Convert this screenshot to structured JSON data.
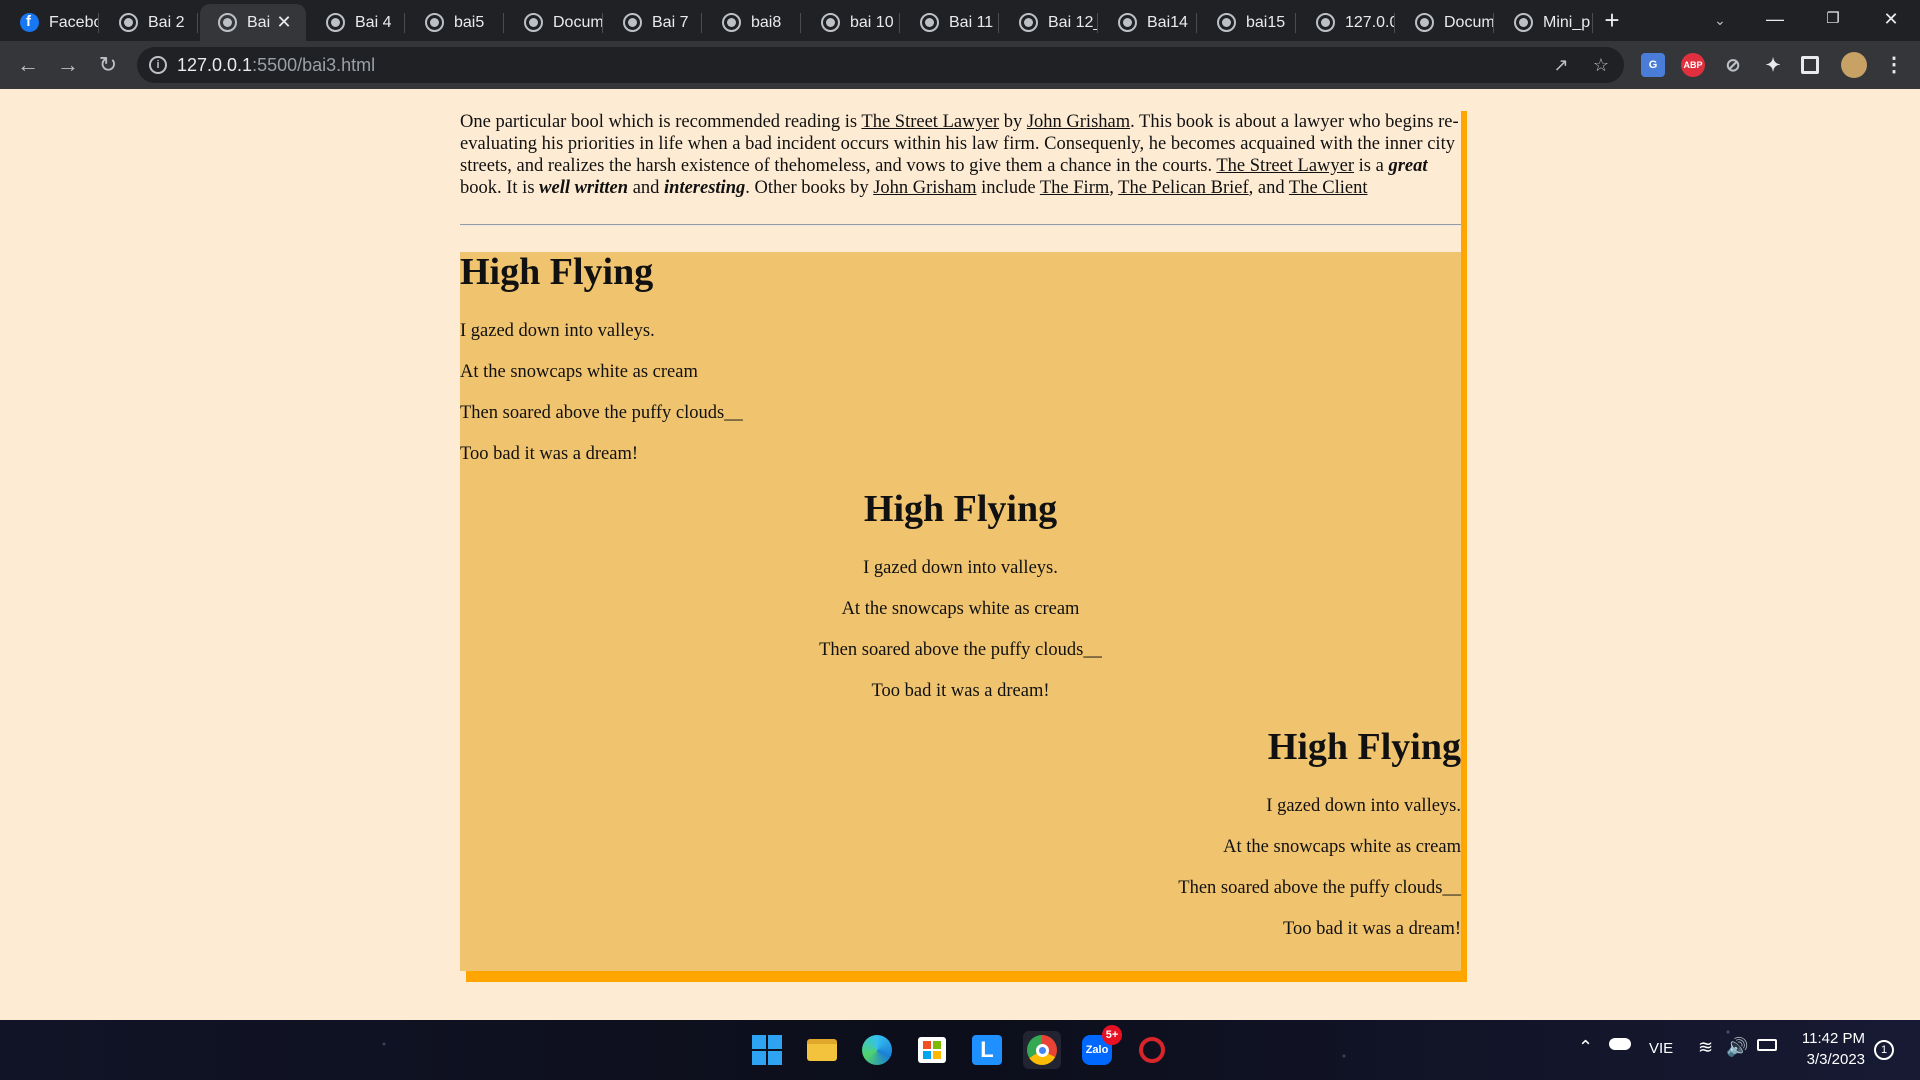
{
  "browser": {
    "tabs": [
      {
        "title": "Facebo",
        "icon": "facebook-icon"
      },
      {
        "title": "Bai 2",
        "icon": "globe-icon"
      },
      {
        "title": "Bai",
        "icon": "globe-icon",
        "active": true
      },
      {
        "title": "Bai 4",
        "icon": "globe-icon"
      },
      {
        "title": "bai5",
        "icon": "globe-icon"
      },
      {
        "title": "Docum",
        "icon": "globe-icon"
      },
      {
        "title": "Bai 7",
        "icon": "globe-icon"
      },
      {
        "title": "bai8",
        "icon": "globe-icon"
      },
      {
        "title": "bai 10",
        "icon": "globe-icon"
      },
      {
        "title": "Bai 11",
        "icon": "globe-icon"
      },
      {
        "title": "Bai 12_",
        "icon": "globe-icon"
      },
      {
        "title": "Bai14",
        "icon": "globe-icon"
      },
      {
        "title": "bai15",
        "icon": "globe-icon"
      },
      {
        "title": "127.0.0",
        "icon": "globe-icon"
      },
      {
        "title": "Docum",
        "icon": "globe-icon"
      },
      {
        "title": "Mini_p",
        "icon": "globe-icon"
      }
    ],
    "close_tab_glyph": "✕",
    "new_tab_glyph": "+",
    "url_host": "127.0.0.1",
    "url_path": ":5500/bai3.html",
    "extensions": {
      "translate": "G",
      "adblock": "ABP",
      "compass": "⊘"
    }
  },
  "page": {
    "intro": {
      "t1": "One particular bool which is recommended reading is ",
      "link_street_lawyer": "The Street Lawyer",
      "t2": " by ",
      "link_author": "John Grisham",
      "t3": ". This book is about a lawyer who begins re-evaluating his priorities in life when a bad incident occurs within his law firm. Consequenly, he becomes acquained with the inner city streets, and realizes the harsh existence of thehomeless, and vows to give them a chance in the courts. ",
      "link_street_lawyer_2": "The Street Lawyer",
      "t4": " is a ",
      "em_great": "great",
      "t5": " book. It is ",
      "em_well_written": "well written",
      "t6": " and ",
      "em_interesting": "interesting",
      "t7": ". Other books by ",
      "link_author_2": "John Grisham",
      "t8": " include ",
      "link_firm": "The Firm",
      "t9": ", ",
      "link_pelican": "The Pelican Brief",
      "t10": ", and ",
      "link_client": "The Client"
    },
    "poems": [
      {
        "align": "left",
        "title": "High Flying",
        "lines": [
          "I gazed down into valleys.",
          "At the snowcaps white as cream",
          "Then soared above the puffy clouds__",
          "Too bad it was a dream!"
        ]
      },
      {
        "align": "center",
        "title": "High Flying",
        "lines": [
          "I gazed down into valleys.",
          "At the snowcaps white as cream",
          "Then soared above the puffy clouds__",
          "Too bad it was a dream!"
        ]
      },
      {
        "align": "right",
        "title": "High Flying",
        "lines": [
          "I gazed down into valleys.",
          "At the snowcaps white as cream",
          "Then soared above the puffy clouds__",
          "Too bad it was a dream!"
        ]
      }
    ],
    "colors": {
      "page_bg": "#fdebd3",
      "poem_bg": "#f0c36f",
      "border_accent": "#ffa500"
    }
  },
  "taskbar": {
    "language": "VIE",
    "time": "11:42 PM",
    "date": "3/3/2023",
    "zalo_badge": "5+",
    "zalo_label": "Zalo",
    "l_app_label": "L",
    "notification_count": "1"
  }
}
